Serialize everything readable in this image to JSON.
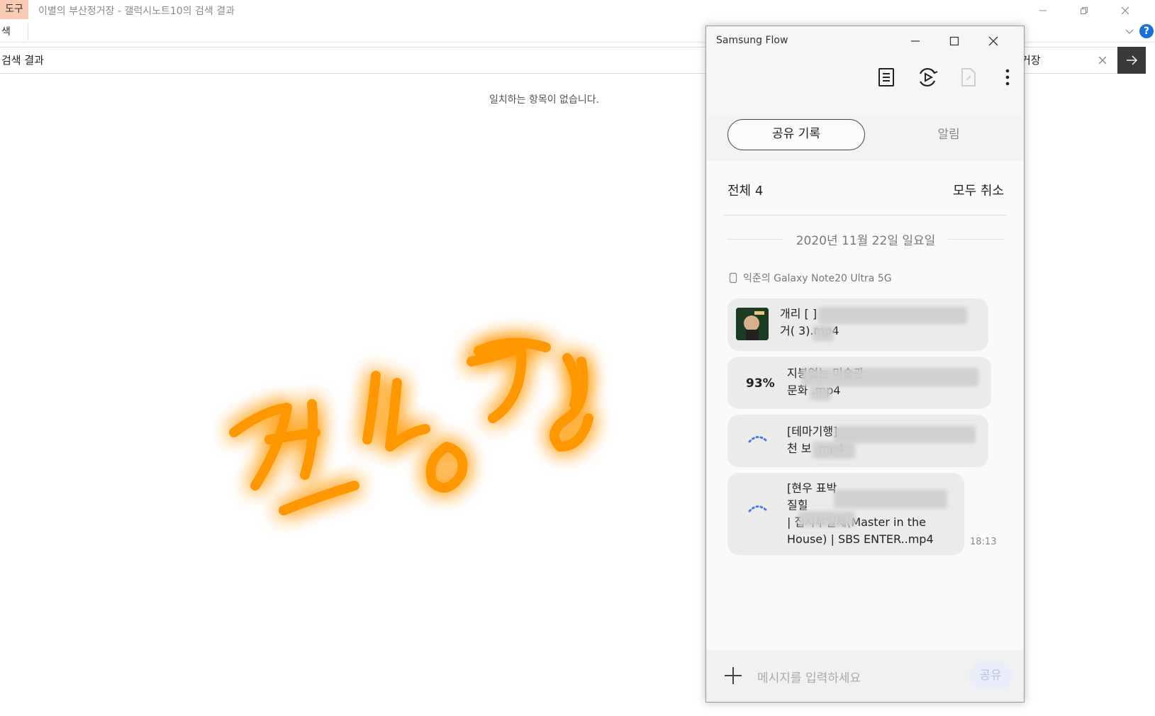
{
  "explorer": {
    "tools_tab": "도구",
    "window_title": "이별의 부산정거장 - 갤럭시노트10의 검색 결과",
    "ribbon_tab": "색",
    "address": "검색 결과",
    "search_value": "거장",
    "empty_message": "일치하는 항목이 없습니다.",
    "help_label": "?"
  },
  "overlay": {
    "handwritten_text": "전송중",
    "color": "#ff9800"
  },
  "flow": {
    "title": "Samsung Flow",
    "tabs": {
      "active": "공유 기록",
      "inactive": "알림"
    },
    "list_header": "전체 4",
    "cancel_all": "모두 취소",
    "date": "2020년 11월 22일 일요일",
    "device": "익준의 Galaxy Note20 Ultra 5G",
    "items": [
      {
        "status": "thumbnail",
        "name": "개리 [        ]\n거(    3).mp4"
      },
      {
        "status": "93%",
        "name": "지붕없는 미술관\n문화      .mp4"
      },
      {
        "status": "loading",
        "name": "[테마기행]\n천 보     .mp4"
      },
      {
        "status": "loading",
        "name": "[현우 표박\n질힐     \n| 집사부일체(Master in the\nHouse) | SBS ENTER..mp4"
      }
    ],
    "last_time": "18:13",
    "input_placeholder": "메시지를 입력하세요",
    "share_button": "공유",
    "accent_color": "#4a7fe0"
  }
}
